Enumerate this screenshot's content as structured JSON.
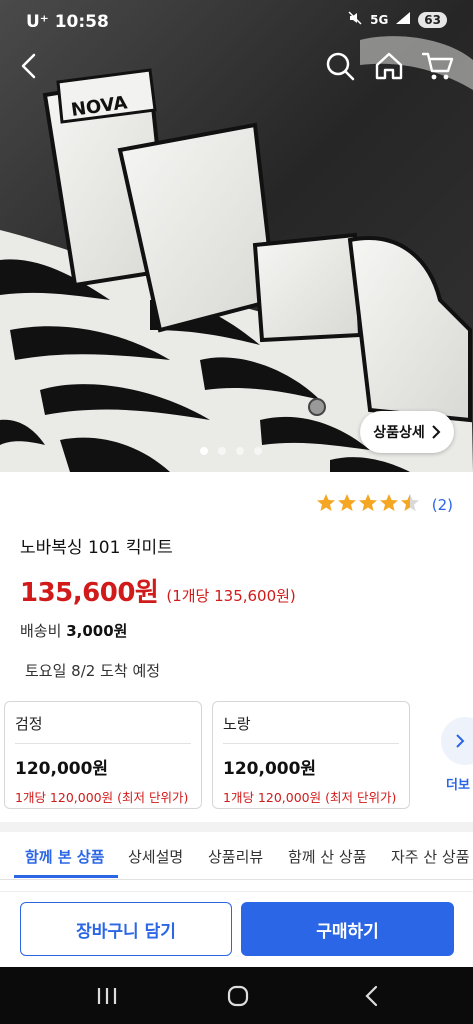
{
  "status_bar": {
    "carrier": "U⁺",
    "time": "10:58",
    "signal": "5G",
    "battery": "63"
  },
  "nav": {
    "back": "back-icon",
    "search": "search-icon",
    "home": "home-icon",
    "cart": "cart-icon"
  },
  "hero": {
    "detail_button": "상품상세",
    "image_count": 4,
    "active_index": 1
  },
  "product": {
    "rating": 4.5,
    "review_count": "(2)",
    "title": "노바복싱 101 킥미트",
    "price": "135,600원",
    "unit_price": "(1개당 135,600원)",
    "shipping_label": "배송비",
    "shipping_fee": "3,000원",
    "arrival": "토요일 8/2 도착 예정"
  },
  "options": [
    {
      "name": "검정",
      "price": "120,000원",
      "unit": "1개당 120,000원 (최저 단위가)"
    },
    {
      "name": "노랑",
      "price": "120,000원",
      "unit": "1개당 120,000원 (최저 단위가)"
    }
  ],
  "more_label": "더보",
  "tabs": [
    "함께 본 상품",
    "상세설명",
    "상품리뷰",
    "함께 산 상품",
    "자주 산 상품"
  ],
  "actions": {
    "cart": "장바구니 담기",
    "buy": "구매하기"
  },
  "colors": {
    "accent": "#2b66e6",
    "price": "#d11a1a",
    "star": "#f5a623"
  }
}
